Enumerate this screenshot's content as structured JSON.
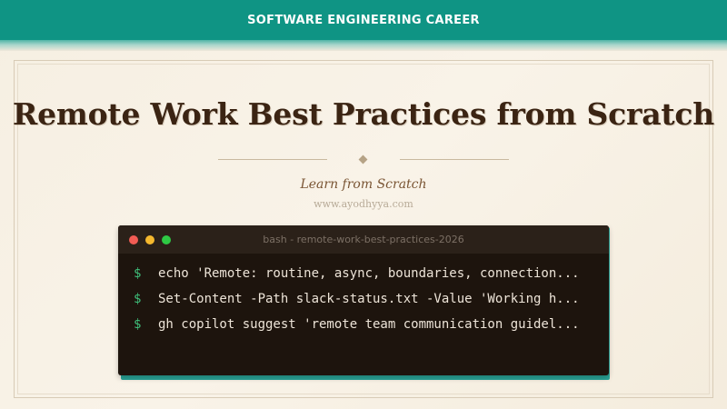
{
  "banner": {
    "label": "SOFTWARE ENGINEERING CAREER"
  },
  "hero": {
    "title": "Remote Work Best Practices from Scratch",
    "subtitle": "Learn from Scratch",
    "website": "www.ayodhyya.com"
  },
  "terminal": {
    "title": "bash - remote-work-best-practices-2026",
    "window_buttons": [
      "close",
      "minimize",
      "maximize"
    ],
    "lines": [
      {
        "prompt": "$",
        "command": "echo 'Remote: routine, async, boundaries, connection..."
      },
      {
        "prompt": "$",
        "command": "Set-Content -Path slack-status.txt -Value 'Working h..."
      },
      {
        "prompt": "$",
        "command": "gh copilot suggest 'remote team communication guidel..."
      }
    ]
  },
  "colors": {
    "banner": "#0f9484",
    "background": "#f6efe2",
    "title": "#3b2413",
    "subtitle": "#7a5534",
    "terminal_bg": "#1d140d",
    "terminal_header": "#2b2119",
    "prompt": "#3fbf7a",
    "command_text": "#ede4d8",
    "terminal_accent": "#2aa79a"
  }
}
